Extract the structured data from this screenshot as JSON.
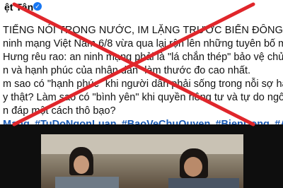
{
  "post": {
    "page_name": "ệt Tân",
    "verified_icon": "check-circle-icon",
    "lines": [
      "TIẾNG NÓI TRONG NƯỚC, IM LẶNG TRƯỚC BIỂN ĐÔNG",
      "ninh mạng Việt Nam 6/8 vừa qua lại rộn lên những tuyên bố mỹ miều",
      "Hưng rêu rao: an ninh mạng phải là \"lá chắn thép\" bảo vệ chủ quyền s",
      "n và hạnh phúc của nhân dân\" làm thước đo cao nhất.",
      "m sao có \"hạnh phúc\" khi người dân phải sống trong nỗi sợ hãi chỉ vì",
      "y thật? Làm sao có \"bình yên\" khi quyền riêng tư và tự do ngôn luận b",
      "n đáp một cách thô bạo?"
    ],
    "hashtags": [
      "Mang",
      "#TuDoNgonLuan",
      "#BaoVeChuQuyen",
      "#BienDong",
      "#AnNinhQuoc"
    ]
  },
  "overlay": {
    "type": "cross-out-x",
    "color": "#e0262b"
  },
  "media": {
    "description_icon": "photo-icon"
  }
}
